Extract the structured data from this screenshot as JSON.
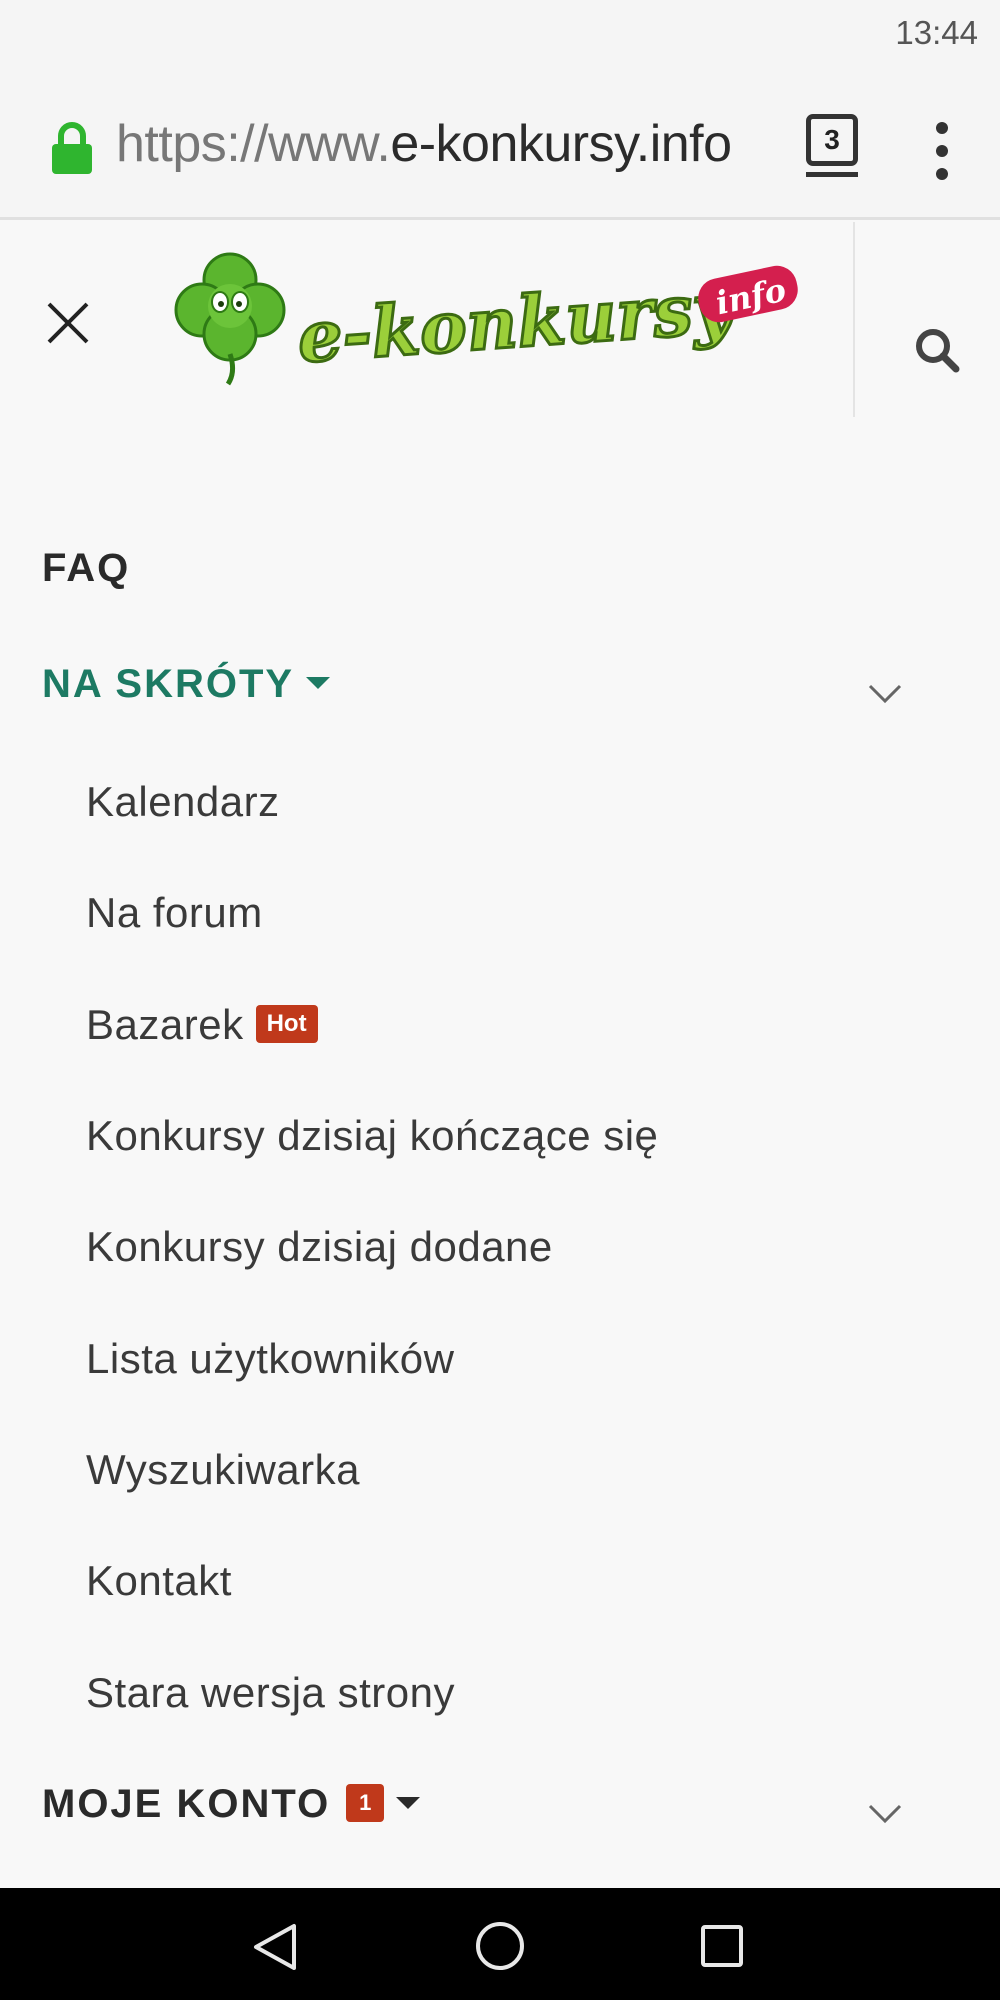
{
  "status_bar": {
    "time": "13:44"
  },
  "browser": {
    "url_scheme": "https://www.",
    "url_host": "e-konkursy.info",
    "tab_count": "3"
  },
  "site": {
    "logo_text": "e-konkursy",
    "logo_suffix": "info"
  },
  "menu": {
    "faq": "FAQ",
    "shortcuts": {
      "label": "NA SKRÓTY",
      "expanded": true,
      "items": [
        {
          "label": "Kalendarz"
        },
        {
          "label": "Na forum"
        },
        {
          "label": "Bazarek",
          "badge": "Hot"
        },
        {
          "label": "Konkursy dzisiaj kończące się"
        },
        {
          "label": "Konkursy dzisiaj dodane"
        },
        {
          "label": "Lista użytkowników"
        },
        {
          "label": "Wyszukiwarka"
        },
        {
          "label": "Kontakt"
        },
        {
          "label": "Stara wersja strony"
        }
      ]
    },
    "account": {
      "label": "MOJE KONTO",
      "badge": "1"
    }
  },
  "colors": {
    "active_menu": "#1d7a63",
    "badge": "#c0391b",
    "lock": "#2fb52f"
  }
}
